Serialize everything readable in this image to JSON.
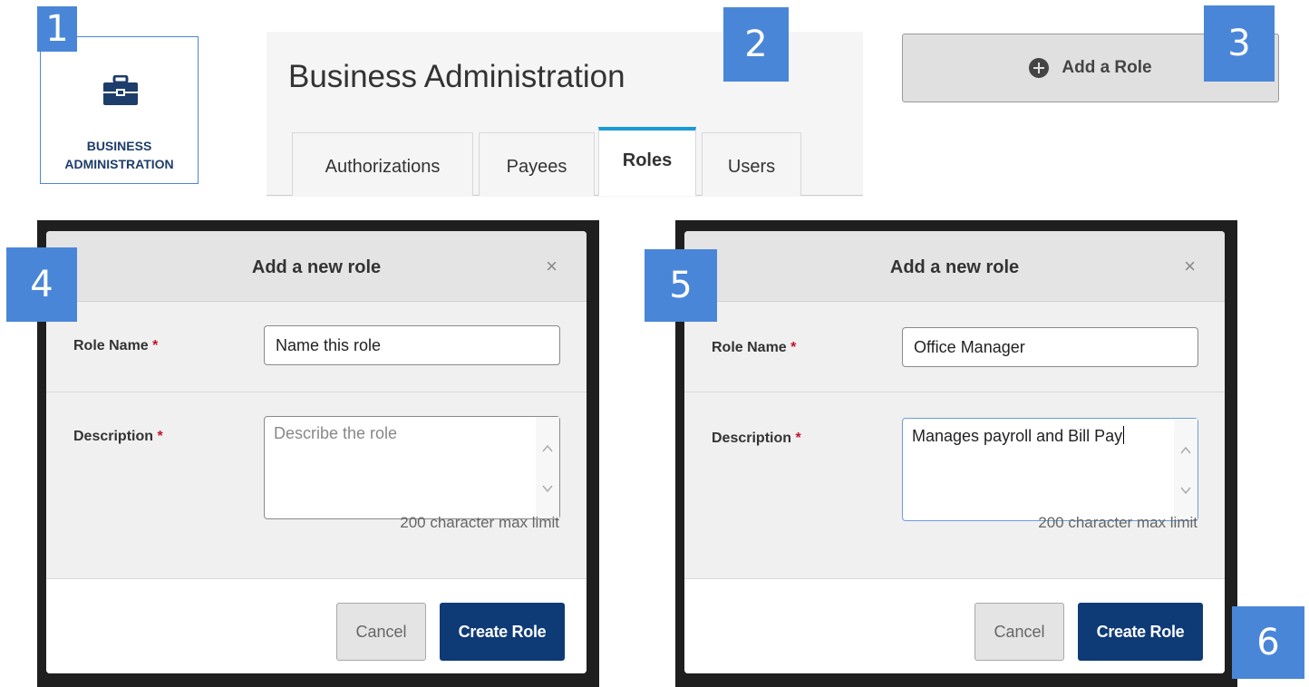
{
  "steps": [
    "1",
    "2",
    "3",
    "4",
    "5",
    "6"
  ],
  "tile": {
    "label_line1": "BUSINESS",
    "label_line2": "ADMINISTRATION",
    "icon": "briefcase-icon"
  },
  "header": {
    "title": "Business Administration",
    "tabs": [
      {
        "label": "Authorizations",
        "active": false
      },
      {
        "label": "Payees",
        "active": false
      },
      {
        "label": "Roles",
        "active": true
      },
      {
        "label": "Users",
        "active": false
      }
    ]
  },
  "add_role_button": {
    "label": "Add a Role",
    "icon": "plus-circle-icon"
  },
  "modal_empty": {
    "title": "Add a new role",
    "close": "×",
    "role_name_label": "Role Name",
    "required_mark": "*",
    "role_name_placeholder": "Name this role",
    "description_label": "Description",
    "description_placeholder": "Describe the role",
    "limit_text": "200 character max limit",
    "cancel_label": "Cancel",
    "create_label": "Create Role"
  },
  "modal_filled": {
    "title": "Add a new role",
    "close": "×",
    "role_name_label": "Role Name",
    "required_mark": "*",
    "role_name_value": "Office Manager",
    "description_label": "Description",
    "description_value": "Manages payroll and Bill Pay",
    "limit_text": "200 character max limit",
    "cancel_label": "Cancel",
    "create_label": "Create Role"
  },
  "colors": {
    "badge": "#4a86d8",
    "tile_text": "#1d3d6b",
    "active_tab_accent": "#1a99d6",
    "primary_button": "#0e3a76",
    "required": "#c8102e"
  }
}
